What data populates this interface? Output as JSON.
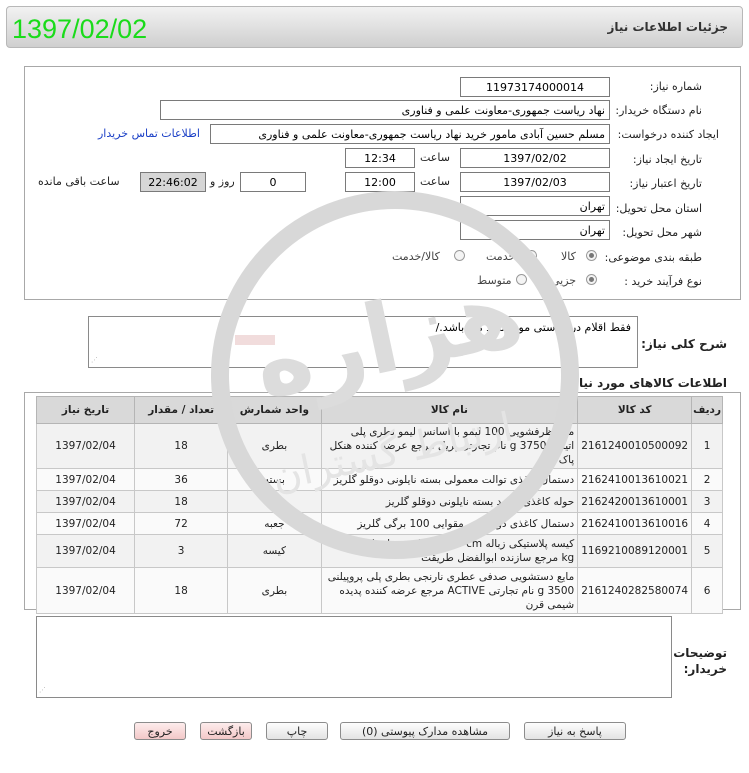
{
  "header": {
    "title": "جزئیات اطلاعات نیاز",
    "date_big": "1397/02/02"
  },
  "form": {
    "need_number": {
      "label": "شماره نیاز:",
      "value": "11973174000014"
    },
    "buyer_org": {
      "label": "نام دستگاه خریدار:",
      "value": "نهاد ریاست جمهوری-معاونت علمی و فناوری"
    },
    "creator": {
      "label": "ایجاد کننده درخواست:",
      "value": "مسلم حسین آبادی مامور خرید نهاد ریاست جمهوری-معاونت علمی و فناوری",
      "contact_link": "اطلاعات تماس خریدار"
    },
    "created_date": {
      "label": "تاریخ ایجاد نیاز:",
      "date": "1397/02/02",
      "time_label": "ساعت",
      "time": "12:34"
    },
    "valid_date": {
      "label": "تاریخ اعتبار نیاز:",
      "date": "1397/02/03",
      "time_label": "ساعت",
      "time": "12:00",
      "days": "0",
      "days_label": "روز و",
      "remaining": "22:46:02",
      "remaining_label": "ساعت باقی مانده"
    },
    "province": {
      "label": "استان محل تحویل:",
      "value": "تهران"
    },
    "city": {
      "label": "شهر محل تحویل:",
      "value": "تهران"
    },
    "category": {
      "label": "طبقه بندی موضوعی:",
      "options": [
        "کالا",
        "خدمت",
        "کالا/خدمت"
      ],
      "selected": "کالا"
    },
    "process": {
      "label": "نوع فرآیند خرید :",
      "options": [
        "جزیی",
        "متوسط"
      ],
      "selected": "جزیی"
    }
  },
  "description": {
    "label": "شرح کلی نیاز:",
    "value": "فقط اقلام درخواستی مورد تایید می باشد./"
  },
  "items_section": {
    "title": "اطلاعات کالاهای مورد نیاز"
  },
  "table": {
    "headers": [
      "ردیف",
      "کد کالا",
      "نام کالا",
      "واحد شمارش",
      "تعداد / مقدار",
      "تاریخ نیاز"
    ],
    "rows": [
      {
        "row": "1",
        "code": "2161240010500092",
        "name": "مایع ظرفشویی 100 لیمو با اسانس لیمو بطری پلی اتیلنی 3750 g نام تجارتی پریل مرجع عرضه کننده هنکل پاک وش",
        "unit": "بطری",
        "qty": "18",
        "date": "1397/02/04"
      },
      {
        "row": "2",
        "code": "2162410013610021",
        "name": "دستمال کاغذی توالت معمولی بسته نایلونی دوقلو گلریز",
        "unit": "بسته",
        "qty": "36",
        "date": "1397/02/04"
      },
      {
        "row": "3",
        "code": "2162420013610001",
        "name": "حوله کاغذی سفید بسته نایلونی دوقلو گلریز",
        "unit": "بسته",
        "qty": "18",
        "date": "1397/02/04"
      },
      {
        "row": "4",
        "code": "2162410013610016",
        "name": "دستمال کاغذی دولا جعبه مقوایی 100 برگی گلریز",
        "unit": "جعبه",
        "qty": "72",
        "date": "1397/02/04"
      },
      {
        "row": "5",
        "code": "1169210089120001",
        "name": "کیسه پلاستیکی زباله 85x120 cm کیسه پلی اتیلنی 20 kg مرجع سازنده ابوالفضل طریقت",
        "unit": "کیسه",
        "qty": "3",
        "date": "1397/02/04"
      },
      {
        "row": "6",
        "code": "2161240282580074",
        "name": "مایع دستشویی صدفی عطری نارنجی بطری پلی پروپیلنی 3500 g نام تجارتی ACTIVE مرجع عرضه کننده پدیده شیمی قرن",
        "unit": "بطری",
        "qty": "18",
        "date": "1397/02/04"
      }
    ]
  },
  "buyer_notes": {
    "label": "توضیحات خریدار:",
    "value": ""
  },
  "buttons": {
    "reply": "پاسخ به نیاز",
    "view_docs": "مشاهده مدارک پیوستی (0)",
    "print": "چاپ",
    "back": "بازگشت",
    "exit": "خروج"
  },
  "watermark": {
    "text": "هزاره",
    "subtext": "ارتباط گستران"
  },
  "colors": {
    "date_big": "#1adb1a",
    "link": "#1a3fc6",
    "panel_border": "#a8a8a8"
  }
}
